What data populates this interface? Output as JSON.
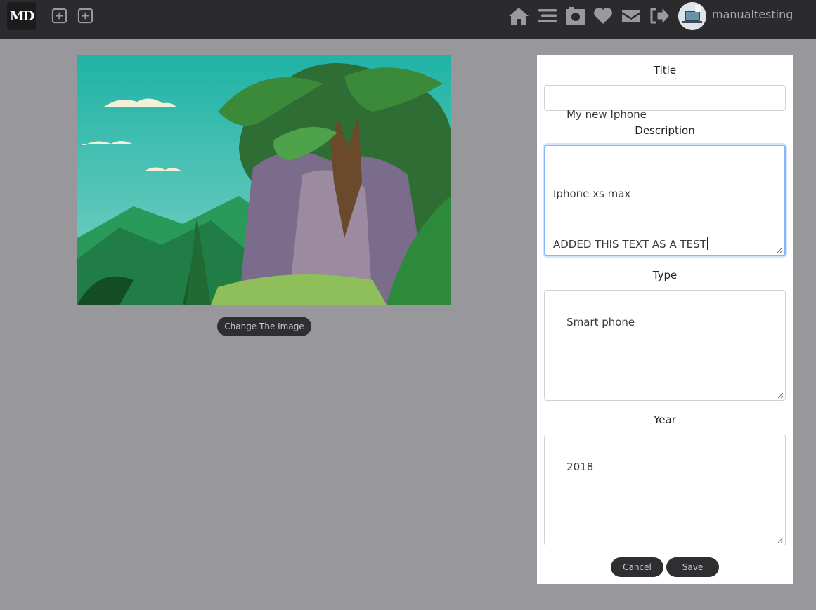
{
  "nav": {
    "logo_text": "MD",
    "username": "manualtesting",
    "add_buttons": [
      {
        "icon": "plus-square-icon"
      },
      {
        "icon": "plus-square-icon"
      }
    ],
    "icons": [
      "home-icon",
      "menu-icon",
      "camera-icon",
      "heart-icon",
      "mail-icon",
      "logout-icon"
    ],
    "avatar_icon": "user-avatar-icon"
  },
  "image": {
    "description_icon": "landscape-image",
    "change_label": "Change The Image"
  },
  "form": {
    "title_label": "Title",
    "title_value": "My new Iphone",
    "description_label": "Description",
    "description_line1": "Iphone xs max",
    "description_line2": "ADDED THIS TEXT AS A TEST",
    "type_label": "Type",
    "type_value": "Smart phone",
    "year_label": "Year",
    "year_value": "2018",
    "cancel_label": "Cancel",
    "save_label": "Save"
  },
  "colors": {
    "topbar": "#2b2b2d",
    "background": "#98979c",
    "button": "#2f2f31",
    "focus_ring": "#86b7fe"
  }
}
